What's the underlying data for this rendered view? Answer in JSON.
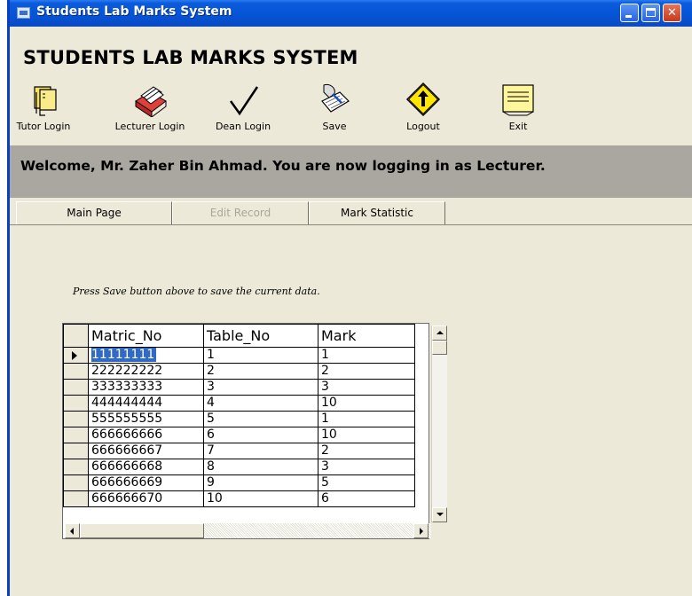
{
  "window": {
    "title": "Students Lab Marks System"
  },
  "app": {
    "heading": "STUDENTS LAB MARKS SYSTEM"
  },
  "toolbar": {
    "items": [
      {
        "label": "Tutor Login",
        "icon": "notebook-icon"
      },
      {
        "label": "Lecturer Login",
        "icon": "card-index-icon"
      },
      {
        "label": "Dean Login",
        "icon": "checkmark-icon"
      },
      {
        "label": "Save",
        "icon": "writing-hand-icon"
      },
      {
        "label": "Logout",
        "icon": "arrow-sign-icon"
      },
      {
        "label": "Exit",
        "icon": "note-pad-icon"
      }
    ]
  },
  "welcome": {
    "text": "Welcome, Mr. Zaher Bin Ahmad. You are now logging in as Lecturer."
  },
  "tabs": [
    {
      "label": "Main Page",
      "state": "active"
    },
    {
      "label": "Edit Record",
      "state": "disabled"
    },
    {
      "label": "Mark Statistic",
      "state": "normal"
    }
  ],
  "main": {
    "note": "Press Save button above to save the current data."
  },
  "grid": {
    "columns": [
      "Matric_No",
      "Table_No",
      "Mark"
    ],
    "rows": [
      [
        "11111111",
        "1",
        "1"
      ],
      [
        "222222222",
        "2",
        "2"
      ],
      [
        "333333333",
        "3",
        "3"
      ],
      [
        "444444444",
        "4",
        "10"
      ],
      [
        "555555555",
        "5",
        "1"
      ],
      [
        "666666666",
        "6",
        "10"
      ],
      [
        "666666667",
        "7",
        "2"
      ],
      [
        "666666668",
        "8",
        "3"
      ],
      [
        "666666669",
        "9",
        "5"
      ],
      [
        "666666670",
        "10",
        "6"
      ]
    ]
  },
  "colors": {
    "titlebar": "#0653D6",
    "banner": "#A9A7A0",
    "window": "#ECE9D8",
    "selection": "#316AC5"
  }
}
